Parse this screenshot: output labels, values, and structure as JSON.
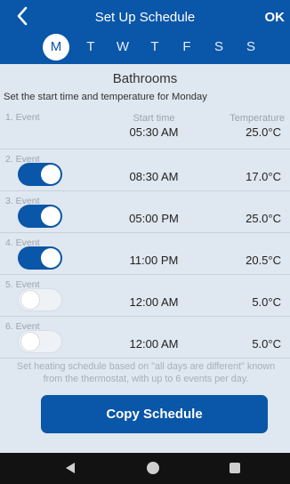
{
  "header": {
    "title": "Set Up Schedule",
    "ok_label": "OK",
    "days": [
      "M",
      "T",
      "W",
      "T",
      "F",
      "S",
      "S"
    ],
    "selected_day": "M"
  },
  "room_name": "Bathrooms",
  "subtitle": "Set the start time and temperature for Monday",
  "columns": {
    "start_time": "Start time",
    "temperature": "Temperature"
  },
  "events": [
    {
      "name": "1. Event",
      "time": "05:30 AM",
      "temperature": "25.0°C",
      "toggle": null
    },
    {
      "name": "2. Event",
      "time": "08:30 AM",
      "temperature": "17.0°C",
      "toggle": true
    },
    {
      "name": "3. Event",
      "time": "05:00 PM",
      "temperature": "25.0°C",
      "toggle": true
    },
    {
      "name": "4. Event",
      "time": "11:00 PM",
      "temperature": "20.5°C",
      "toggle": true
    },
    {
      "name": "5. Event",
      "time": "12:00 AM",
      "temperature": "5.0°C",
      "toggle": false
    },
    {
      "name": "6. Event",
      "time": "12:00 AM",
      "temperature": "5.0°C",
      "toggle": false
    }
  ],
  "note": "Set heating schedule based on \"all days are different\" known from the thermostat, with up to 6 events per day.",
  "copy_button": "Copy Schedule",
  "colors": {
    "primary": "#0a56a8",
    "background": "#dfe7f0",
    "navbar": "#121212"
  },
  "icons": {
    "back": "chevron-left-icon",
    "nav_back": "triangle-back-icon",
    "nav_home": "circle-home-icon",
    "nav_recent": "square-recents-icon"
  }
}
